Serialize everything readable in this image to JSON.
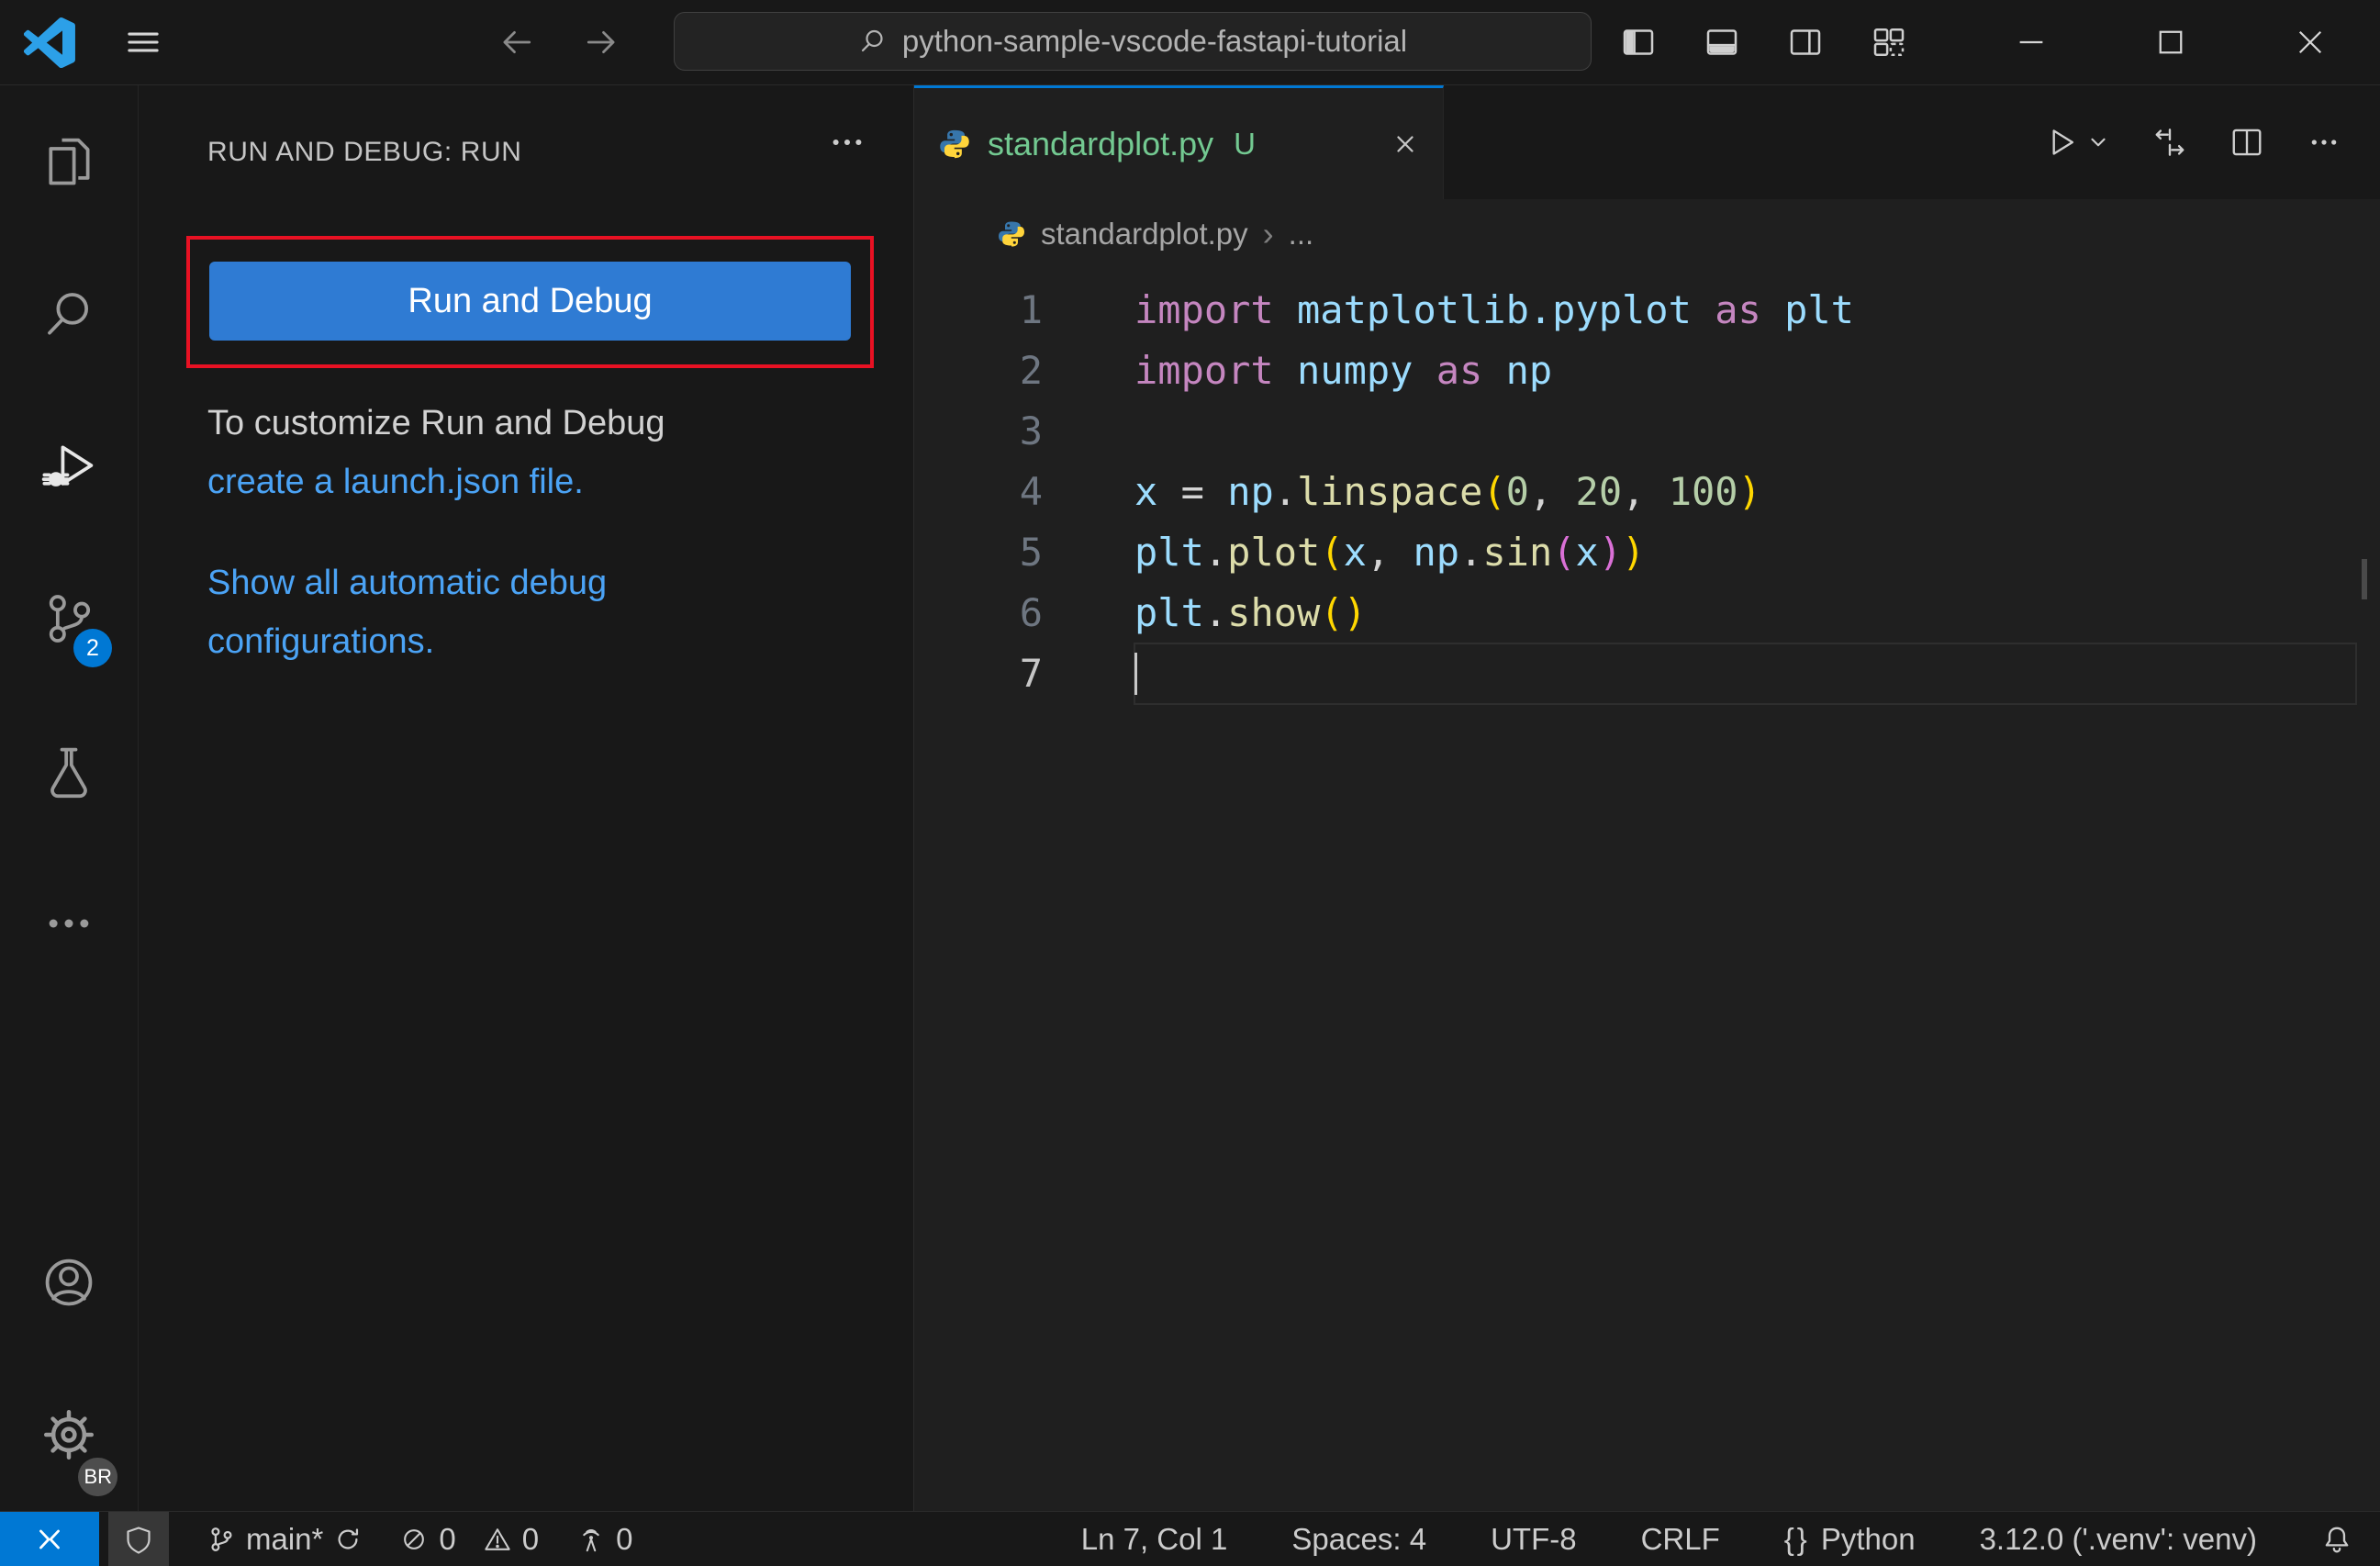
{
  "titlebar": {
    "search_text": "python-sample-vscode-fastapi-tutorial"
  },
  "activity_bar": {
    "scm_badge": "2",
    "profile_badge": "BR"
  },
  "sidebar": {
    "title": "RUN AND DEBUG: RUN",
    "run_button": "Run and Debug",
    "customize_text": "To customize Run and Debug",
    "launch_link": "create a launch.json file.",
    "show_all_link": "Show all automatic debug configurations."
  },
  "editor": {
    "tab": {
      "label": "standardplot.py",
      "git_status": "U"
    },
    "breadcrumb": {
      "file": "standardplot.py"
    },
    "code": {
      "lines": [
        {
          "n": "1",
          "t": [
            [
              "import",
              "kw"
            ],
            [
              " ",
              "pl"
            ],
            [
              "matplotlib.pyplot",
              "id"
            ],
            [
              " ",
              "pl"
            ],
            [
              "as",
              "kw"
            ],
            [
              " ",
              "pl"
            ],
            [
              "plt",
              "id"
            ]
          ]
        },
        {
          "n": "2",
          "t": [
            [
              "import",
              "kw"
            ],
            [
              " ",
              "pl"
            ],
            [
              "numpy",
              "id"
            ],
            [
              " ",
              "pl"
            ],
            [
              "as",
              "kw"
            ],
            [
              " ",
              "pl"
            ],
            [
              "np",
              "id"
            ]
          ]
        },
        {
          "n": "3",
          "t": []
        },
        {
          "n": "4",
          "t": [
            [
              "x",
              "id"
            ],
            [
              " ",
              "pl"
            ],
            [
              "=",
              "pl"
            ],
            [
              " ",
              "pl"
            ],
            [
              "np",
              "id"
            ],
            [
              ".",
              "pl"
            ],
            [
              "linspace",
              "fn"
            ],
            [
              "(",
              "p1"
            ],
            [
              "0",
              "num"
            ],
            [
              ",",
              "pl"
            ],
            [
              " ",
              "pl"
            ],
            [
              "20",
              "num"
            ],
            [
              ",",
              "pl"
            ],
            [
              " ",
              "pl"
            ],
            [
              "100",
              "num"
            ],
            [
              ")",
              "p1"
            ]
          ]
        },
        {
          "n": "5",
          "t": [
            [
              "plt",
              "id"
            ],
            [
              ".",
              "pl"
            ],
            [
              "plot",
              "fn"
            ],
            [
              "(",
              "p1"
            ],
            [
              "x",
              "id"
            ],
            [
              ",",
              "pl"
            ],
            [
              " ",
              "pl"
            ],
            [
              "np",
              "id"
            ],
            [
              ".",
              "pl"
            ],
            [
              "sin",
              "fn"
            ],
            [
              "(",
              "p2"
            ],
            [
              "x",
              "id"
            ],
            [
              ")",
              "p2"
            ],
            [
              ")",
              "p1"
            ]
          ]
        },
        {
          "n": "6",
          "t": [
            [
              "plt",
              "id"
            ],
            [
              ".",
              "pl"
            ],
            [
              "show",
              "fn"
            ],
            [
              "(",
              "p1"
            ],
            [
              ")",
              "p1"
            ]
          ]
        },
        {
          "n": "7",
          "t": [],
          "current": true,
          "cursor": true
        }
      ]
    }
  },
  "statusbar": {
    "branch": "main*",
    "errors": "0",
    "warnings": "0",
    "ports": "0",
    "line_col": "Ln 7, Col 1",
    "indent": "Spaces: 4",
    "encoding": "UTF-8",
    "eol": "CRLF",
    "language": "Python",
    "interpreter": "3.12.0 ('.venv': venv)"
  },
  "icons": {
    "breadcrumb_chevron": "›",
    "breadcrumb_more": "...",
    "braces": "{}"
  },
  "colors": {
    "accent": "#0078d4",
    "button": "#2f7bd3",
    "link": "#4ba3f5",
    "annotation_red": "#e81123",
    "untracked_green": "#73c991",
    "editor_bg": "#1f1f1f",
    "chrome_bg": "#181818",
    "logo_blue": "#2CA0E8"
  }
}
